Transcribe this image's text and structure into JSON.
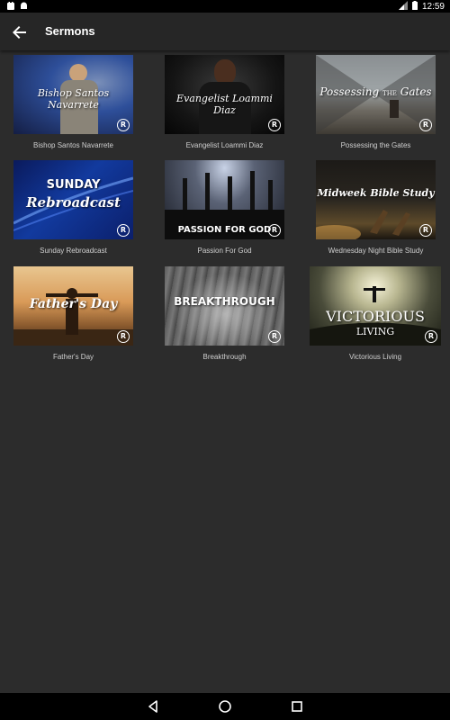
{
  "status_bar": {
    "time": "12:59"
  },
  "app_bar": {
    "title": "Sermons"
  },
  "sermons": [
    {
      "caption": "Bishop Santos Navarrete",
      "thumb_title": "Bishop Santos Navarrete"
    },
    {
      "caption": "Evangelist Loammi Diaz",
      "thumb_title": "Evangelist Loammi Diaz"
    },
    {
      "caption": "Possessing the Gates",
      "thumb_title_main": "Possessing",
      "thumb_title_small": "THE",
      "thumb_title_end": "Gates"
    },
    {
      "caption": "Sunday Rebroadcast",
      "thumb_title_top": "SUNDAY",
      "thumb_title_bottom": "Rebroadcast"
    },
    {
      "caption": "Passion For God",
      "thumb_title": "PASSION FOR GOD"
    },
    {
      "caption": "Wednesday Night Bible Study",
      "thumb_title": "Midweek Bible Study"
    },
    {
      "caption": "Father's Day",
      "thumb_title": "Father's Day"
    },
    {
      "caption": "Breakthrough",
      "thumb_title": "BREAKTHROUGH"
    },
    {
      "caption": "Victorious Living",
      "thumb_title_top": "VICTORIOUS",
      "thumb_title_bottom": "LIVING"
    }
  ],
  "badge_letter": "R",
  "colors": {
    "background": "#2c2c2c",
    "app_bar": "#262626",
    "caption": "#cfcfcf"
  }
}
